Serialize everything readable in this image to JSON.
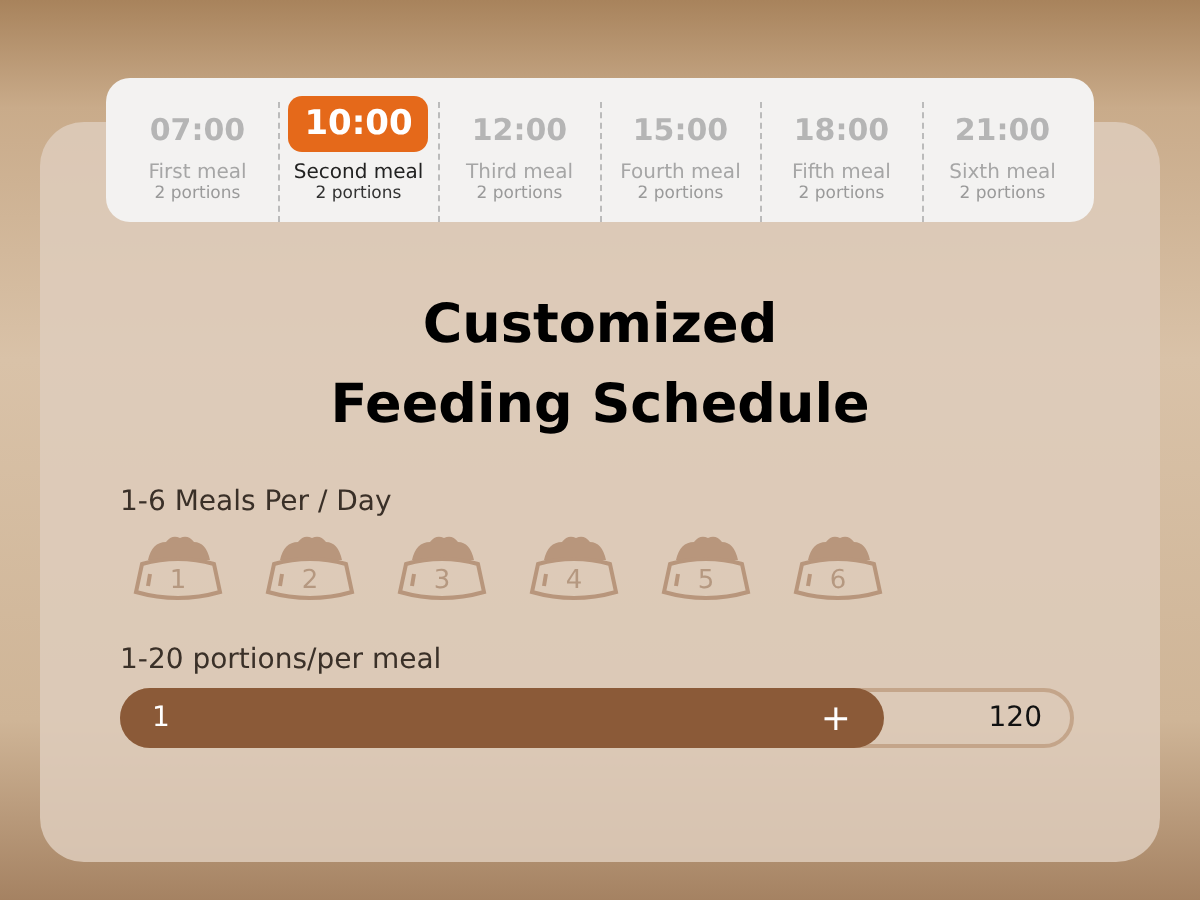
{
  "schedule": [
    {
      "time": "07:00",
      "meal": "First meal",
      "portions": "2 portions",
      "selected": false
    },
    {
      "time": "10:00",
      "meal": "Second meal",
      "portions": "2 portions",
      "selected": true
    },
    {
      "time": "12:00",
      "meal": "Third meal",
      "portions": "2 portions",
      "selected": false
    },
    {
      "time": "15:00",
      "meal": "Fourth meal",
      "portions": "2 portions",
      "selected": false
    },
    {
      "time": "18:00",
      "meal": "Fifth meal",
      "portions": "2 portions",
      "selected": false
    },
    {
      "time": "21:00",
      "meal": "Sixth meal",
      "portions": "2 portions",
      "selected": false
    }
  ],
  "title": [
    "Customized",
    "Feeding Schedule"
  ],
  "meals_label": "1-6 Meals Per / Day",
  "bowls": [
    "1",
    "2",
    "3",
    "4",
    "5",
    "6"
  ],
  "portions_label": "1-20 portions/per meal",
  "slider": {
    "min": "1",
    "plus": "+",
    "max": "120",
    "level": 0.8
  }
}
